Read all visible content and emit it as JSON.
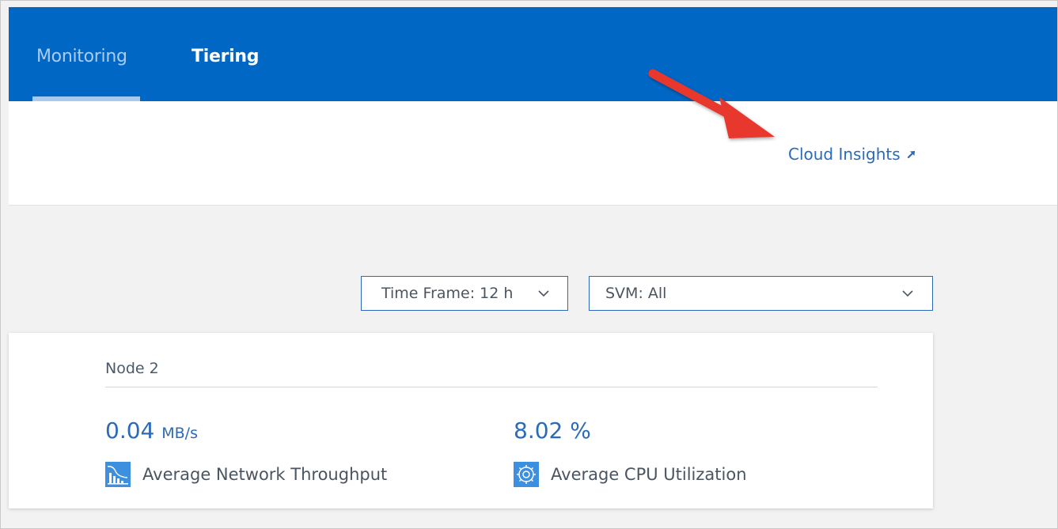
{
  "tabs": [
    {
      "label": "Monitoring",
      "active": true
    },
    {
      "label": "Tiering",
      "active": false
    }
  ],
  "links": {
    "cloud_insights": "Cloud Insights",
    "cloud_insights_icon": "external-link-icon"
  },
  "filters": {
    "time_frame": "Time Frame: 12 h",
    "svm": "SVM: All"
  },
  "node": {
    "title": "Node 2",
    "metrics": [
      {
        "value": "0.04",
        "unit": "MB/s",
        "label": "Average Network Throughput",
        "icon": "network-chart-icon"
      },
      {
        "value": "8.02",
        "unit": "%",
        "label": "Average CPU Utilization",
        "icon": "gear-icon"
      }
    ]
  },
  "colors": {
    "header_bg": "#0067c5",
    "accent": "#2a6ab8",
    "annotation_arrow": "#e8382e"
  }
}
